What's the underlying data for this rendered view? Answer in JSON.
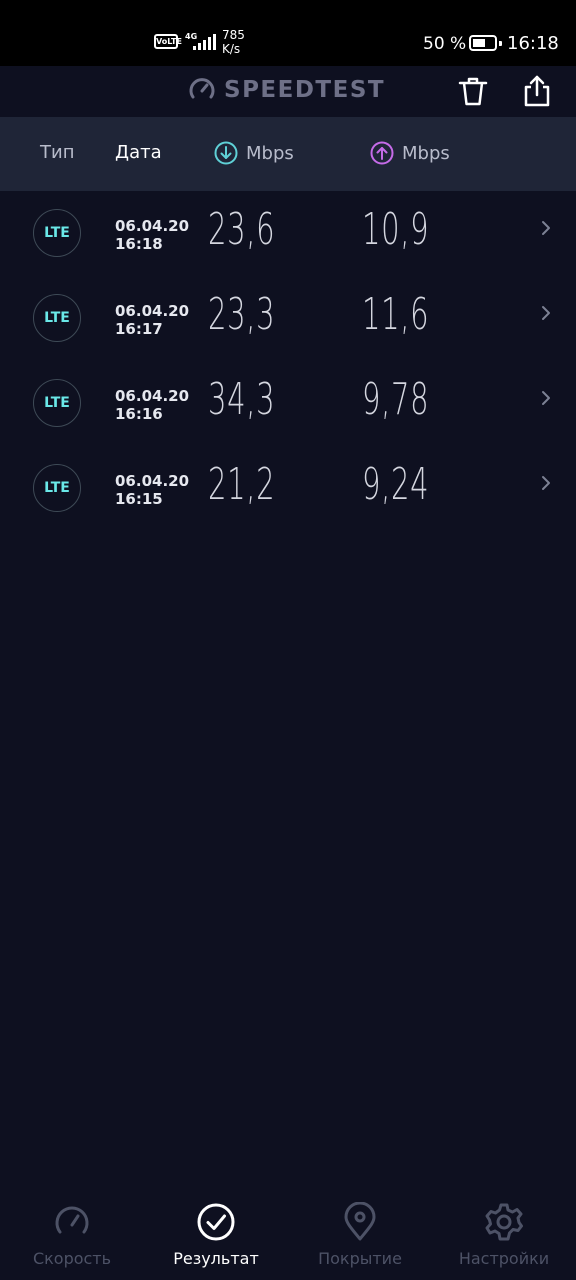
{
  "status_bar": {
    "volte": "VoLTE",
    "network_type": "4G",
    "net_speed_value": "785",
    "net_speed_unit": "K/s",
    "battery_percent": "50 %",
    "time": "16:18"
  },
  "header": {
    "title": "SPEEDTEST",
    "delete_icon": "trash-icon",
    "share_icon": "share-icon"
  },
  "columns": {
    "type": "Тип",
    "date": "Дата",
    "download": "Mbps",
    "upload": "Mbps",
    "download_color": "#5fd0d6",
    "upload_color": "#c56be8"
  },
  "results": [
    {
      "type": "LTE",
      "date": "06.04.20",
      "time": "16:18",
      "download": "23,6",
      "upload": "10,9"
    },
    {
      "type": "LTE",
      "date": "06.04.20",
      "time": "16:17",
      "download": "23,3",
      "upload": "11,6"
    },
    {
      "type": "LTE",
      "date": "06.04.20",
      "time": "16:16",
      "download": "34,3",
      "upload": "9,78"
    },
    {
      "type": "LTE",
      "date": "06.04.20",
      "time": "16:15",
      "download": "21,2",
      "upload": "9,24"
    }
  ],
  "nav": [
    {
      "label": "Скорость",
      "icon": "speedometer-icon",
      "active": false
    },
    {
      "label": "Результат",
      "icon": "check-circle-icon",
      "active": true
    },
    {
      "label": "Покрытие",
      "icon": "map-pin-icon",
      "active": false
    },
    {
      "label": "Настройки",
      "icon": "gear-icon",
      "active": false
    }
  ]
}
